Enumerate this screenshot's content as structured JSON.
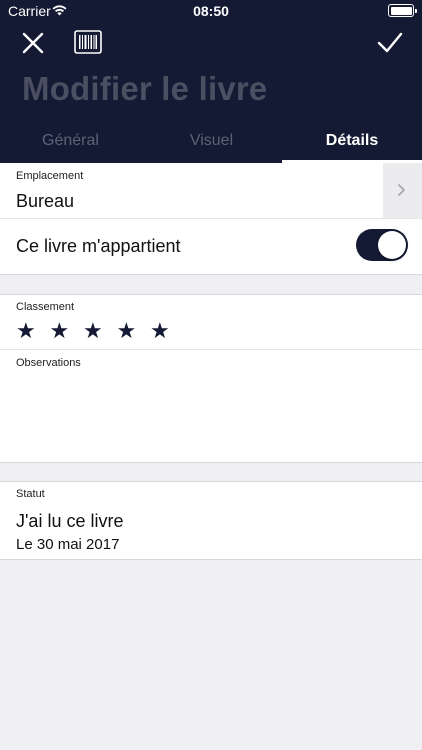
{
  "status_bar": {
    "carrier": "Carrier",
    "time": "08:50"
  },
  "header": {
    "title": "Modifier le livre"
  },
  "tabs": [
    {
      "label": "Général",
      "active": false
    },
    {
      "label": "Visuel",
      "active": false
    },
    {
      "label": "Détails",
      "active": true
    }
  ],
  "location": {
    "label": "Emplacement",
    "value": "Bureau"
  },
  "ownership": {
    "label": "Ce livre m'appartient",
    "on": true
  },
  "rating": {
    "label": "Classement",
    "stars": [
      "★",
      "★",
      "★",
      "★",
      "★"
    ]
  },
  "notes": {
    "label": "Observations",
    "value": ""
  },
  "status": {
    "label": "Statut",
    "value": "J'ai lu ce livre",
    "date": "Le 30 mai 2017"
  },
  "colors": {
    "header_bg": "#141a33",
    "page_bg": "#efeff4",
    "inactive_tab": "#5c6275"
  },
  "icons": [
    "close-icon",
    "barcode-icon",
    "checkmark-icon",
    "chevron-right-icon",
    "wifi-icon",
    "battery-icon",
    "star-icon"
  ]
}
